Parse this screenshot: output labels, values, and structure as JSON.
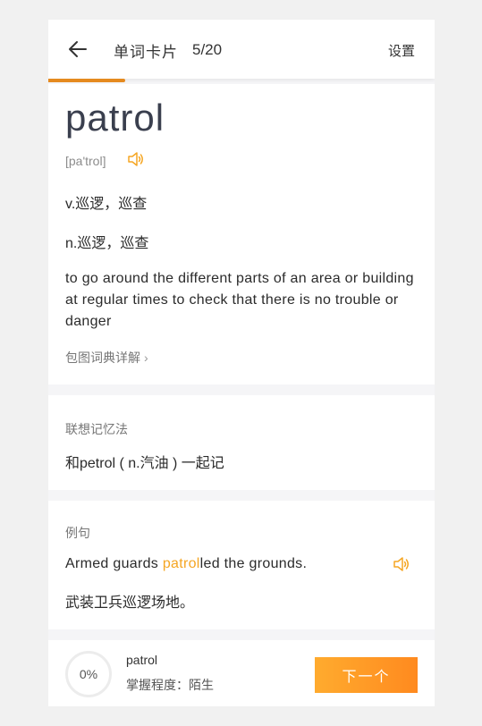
{
  "header": {
    "title": "单词卡片",
    "progress": "5/20",
    "settings_label": "设置"
  },
  "progress_bar": {
    "fraction": 0.2,
    "color": "#e58a1f"
  },
  "word_card": {
    "word": "patrol",
    "phonetic": "[pa'trol]",
    "def_verb": "v.巡逻，巡查",
    "def_noun": "n.巡逻，巡查",
    "def_english": "to go around the different parts of an area or building at regular times to check that there is no trouble or danger",
    "dict_link": "包图词典详解"
  },
  "memo_card": {
    "label": "联想记忆法",
    "text": "和petrol ( n.汽油 ) 一起记"
  },
  "example_card": {
    "label": "例句",
    "en_before": "Armed guards ",
    "en_highlight": "patrol",
    "en_after": "led the grounds.",
    "cn": "武装卫兵巡逻场地。"
  },
  "footer": {
    "percent": "0%",
    "word": "patrol",
    "level": "掌握程度：陌生",
    "next_label": "下一个"
  },
  "colors": {
    "accent": "#f5a623",
    "button": "#ff9a26"
  },
  "icons": [
    "back-arrow-icon",
    "speaker-icon"
  ]
}
